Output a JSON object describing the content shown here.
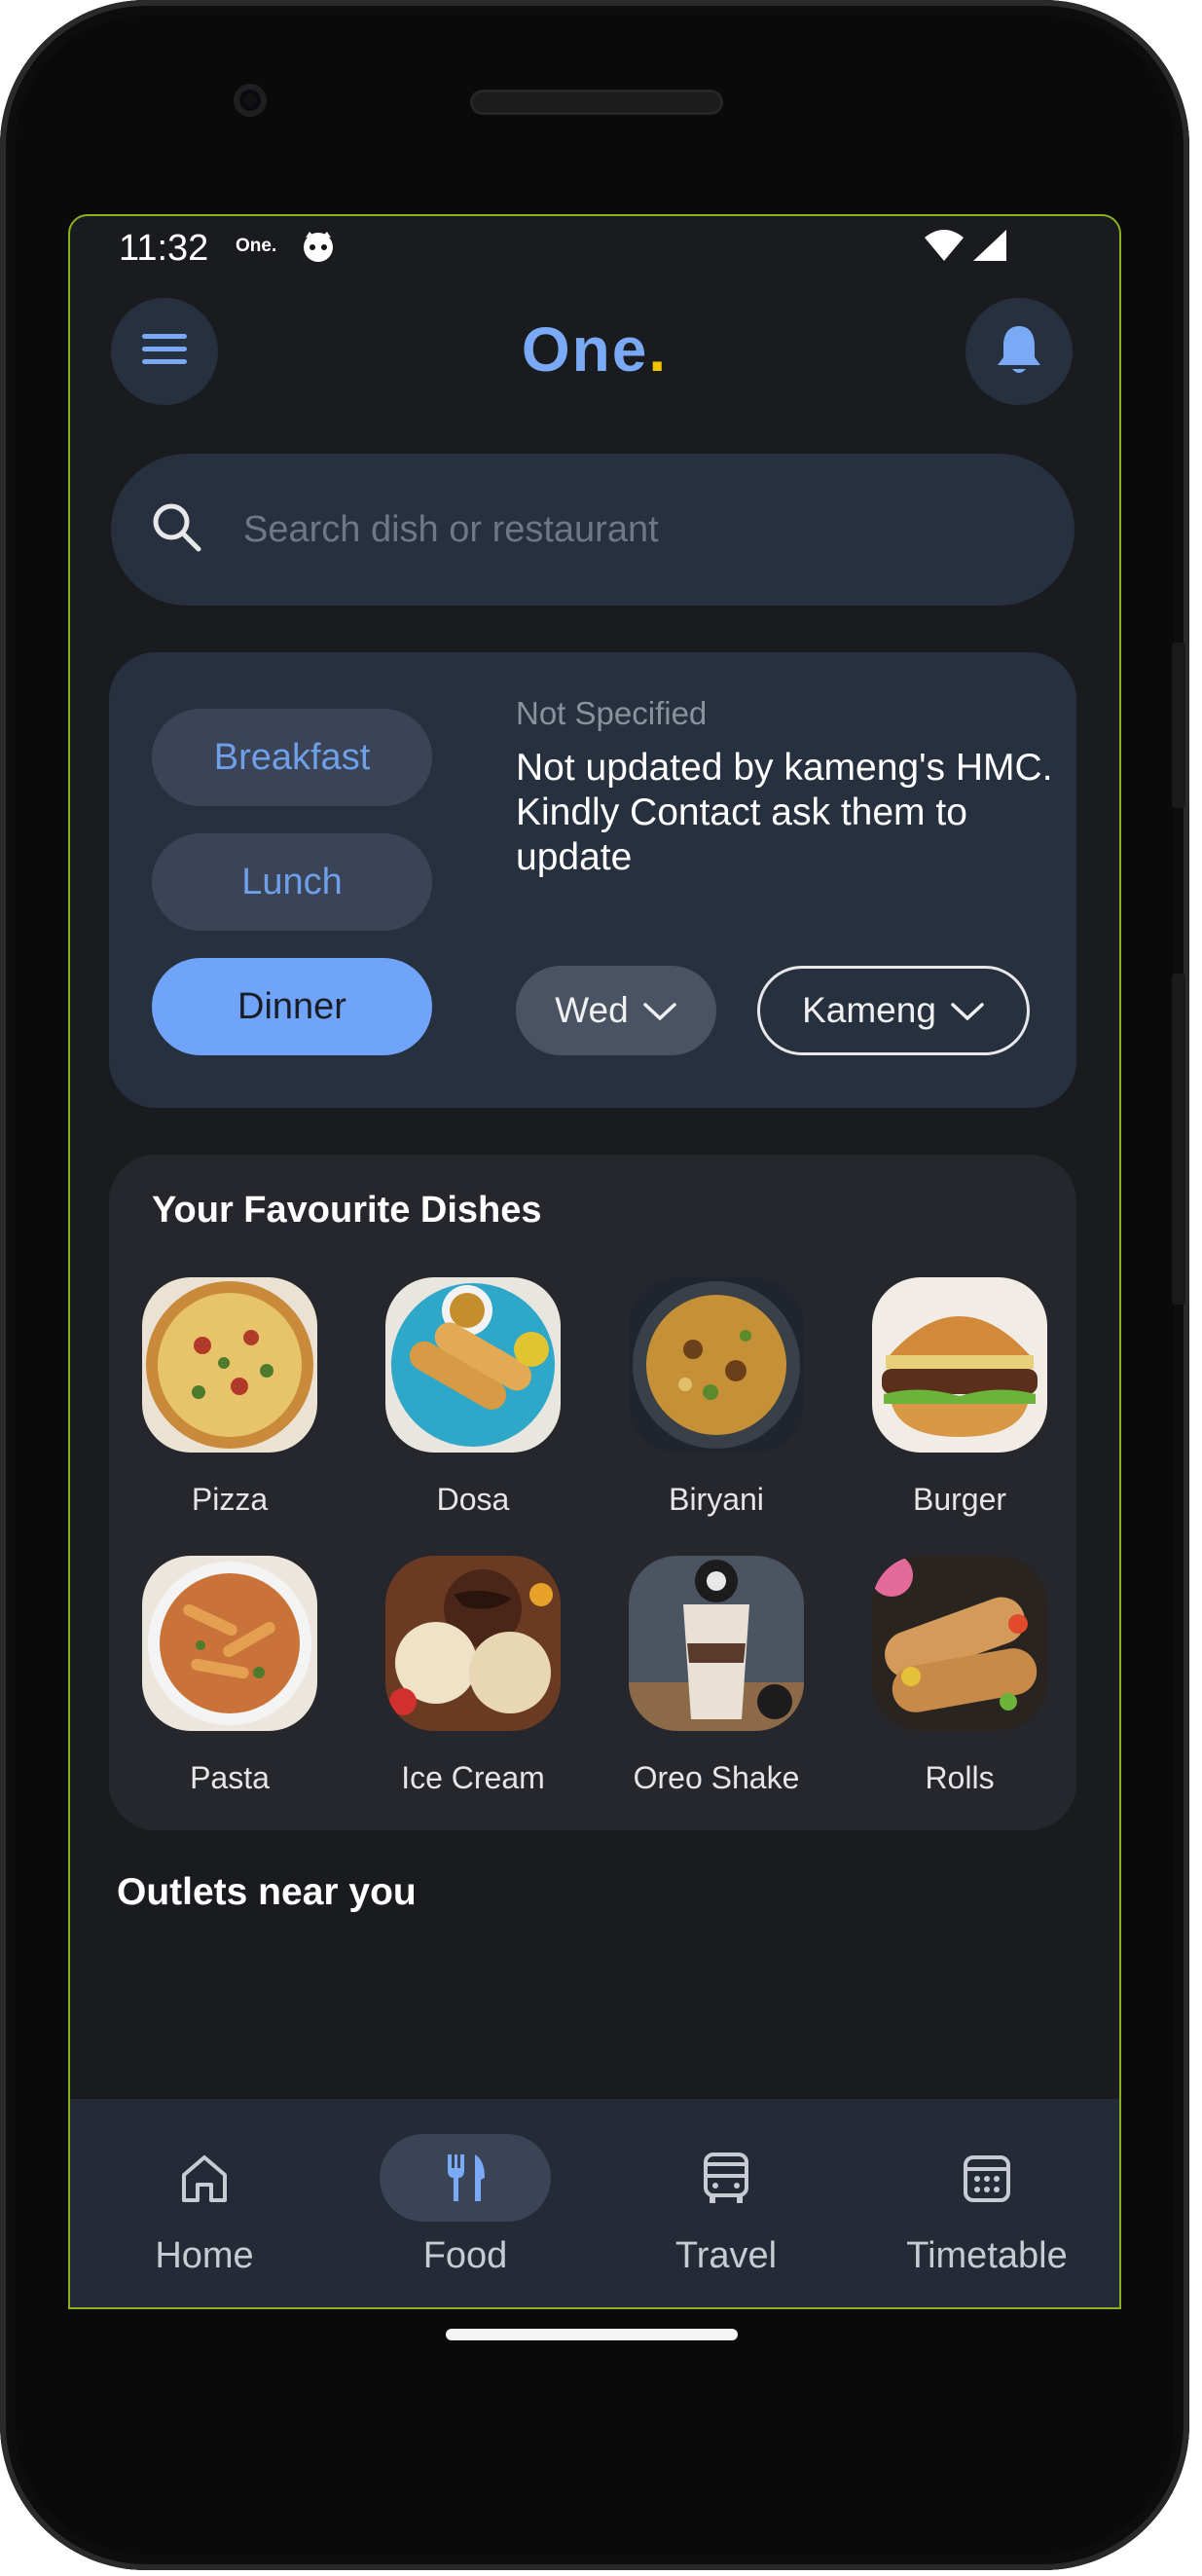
{
  "status_bar": {
    "time": "11:32",
    "app_badge": "One."
  },
  "header": {
    "logo_text": "One",
    "logo_dot": "."
  },
  "search": {
    "placeholder": "Search dish or restaurant"
  },
  "meal": {
    "tabs": [
      {
        "label": "Breakfast",
        "selected": false
      },
      {
        "label": "Lunch",
        "selected": false
      },
      {
        "label": "Dinner",
        "selected": true
      }
    ],
    "status": "Not Specified",
    "message": "Not updated by kameng's HMC. Kindly Contact ask them to update",
    "day_select": "Wed",
    "hostel_select": "Kameng"
  },
  "favourites": {
    "title": "Your Favourite Dishes",
    "dishes": [
      {
        "label": "Pizza"
      },
      {
        "label": "Dosa"
      },
      {
        "label": "Biryani"
      },
      {
        "label": "Burger"
      },
      {
        "label": "Pasta"
      },
      {
        "label": "Ice Cream"
      },
      {
        "label": "Oreo Shake"
      },
      {
        "label": "Rolls"
      }
    ]
  },
  "outlets": {
    "title": "Outlets near you"
  },
  "nav": {
    "items": [
      {
        "label": "Home",
        "icon": "home-icon",
        "active": false
      },
      {
        "label": "Food",
        "icon": "fork-knife-icon",
        "active": true
      },
      {
        "label": "Travel",
        "icon": "bus-icon",
        "active": false
      },
      {
        "label": "Timetable",
        "icon": "calendar-icon",
        "active": false
      }
    ]
  },
  "colors": {
    "accent": "#6fa4f8",
    "background": "#1a1b1f",
    "card": "#27303f",
    "logo_dot": "#f2c300"
  }
}
